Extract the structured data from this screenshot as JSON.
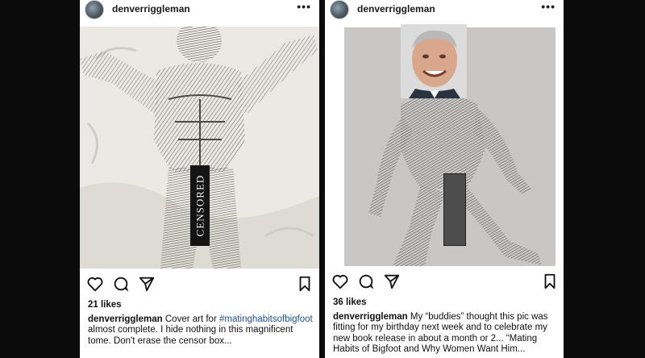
{
  "posts": [
    {
      "username": "denverriggleman",
      "more": "•••",
      "likes": "21 likes",
      "caption_user": "denverriggleman",
      "caption_pre": " Cover art for ",
      "caption_hashtag": "#matinghabitsofbigfoot",
      "caption_post": " almost complete.  I hide nothing in this magnificent tome. Don't erase the censor box...",
      "censor_text": "CENSORED"
    },
    {
      "username": "denverriggleman",
      "more": "•••",
      "likes": "36 likes",
      "caption_user": "denverriggleman",
      "caption_text": " My “buddies” thought this pic was fitting for my birthday next week and to celebrate my new book release in about a month or 2... “Mating Habits of Bigfoot and Why Women Want Him..."
    }
  ],
  "icons": [
    "heart-icon",
    "comment-icon",
    "share-icon",
    "bookmark-icon",
    "more-icon"
  ],
  "colors": {
    "background": "#0b0b0b",
    "card": "#ffffff",
    "hashtag": "#1d4f91"
  }
}
